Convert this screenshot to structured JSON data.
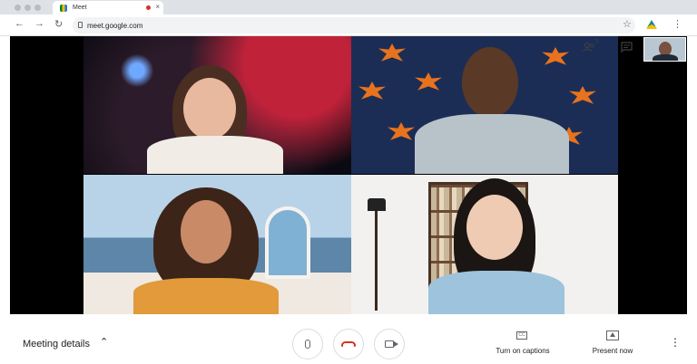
{
  "browser": {
    "tab_title": "Meet",
    "tab_close": "×",
    "url": "meet.google.com",
    "nav_back": "←",
    "nav_forward": "→",
    "nav_reload": "↻",
    "star": "☆",
    "menu": "⋮"
  },
  "meeting": {
    "participants_badge": "5",
    "details_label": "Meeting details",
    "details_chevron": "⌃"
  },
  "controls": {
    "captions_label": "Turn on captions",
    "captions_icon_text": "CC",
    "present_label": "Present now",
    "more": "⋮"
  },
  "colors": {
    "hangup": "#d93025",
    "accent": "#1a73e8"
  }
}
